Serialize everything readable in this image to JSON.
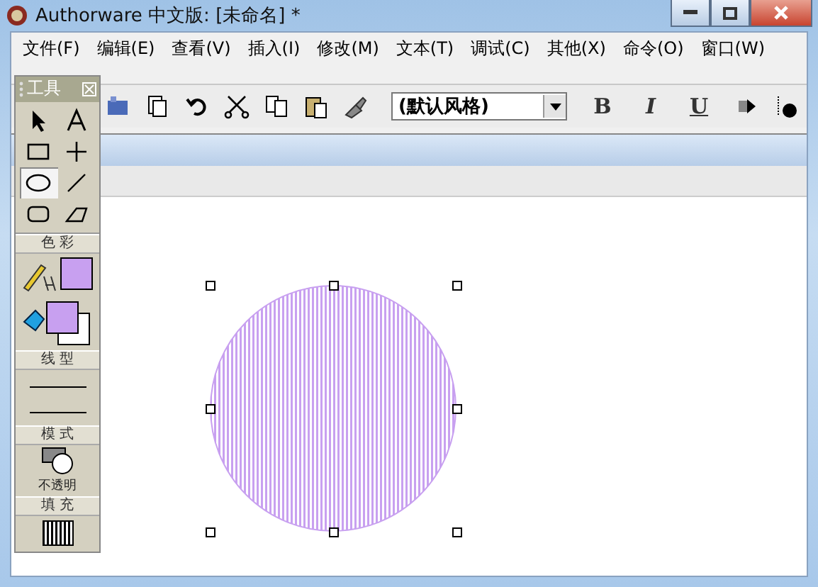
{
  "window": {
    "title": "Authorware 中文版: [未命名] *"
  },
  "menu": [
    "文件(F)",
    "编辑(E)",
    "查看(V)",
    "插入(I)",
    "修改(M)",
    "文本(T)",
    "调试(C)",
    "其他(X)",
    "命令(O)",
    "窗口(W)"
  ],
  "toolbar": {
    "style_select": {
      "value": "(默认风格)"
    },
    "format_buttons": [
      "B",
      "I",
      "U"
    ]
  },
  "toolbox": {
    "title": "工具",
    "tools": [
      {
        "kind": "pointer",
        "selected": false
      },
      {
        "kind": "text",
        "selected": false
      },
      {
        "kind": "rect",
        "selected": false
      },
      {
        "kind": "cross",
        "selected": false
      },
      {
        "kind": "ellipse",
        "selected": true
      },
      {
        "kind": "line",
        "selected": false
      },
      {
        "kind": "rounded-rect",
        "selected": false
      },
      {
        "kind": "polygon",
        "selected": false
      }
    ],
    "color_label": "色 彩",
    "swatches": [
      {
        "color": "#c8a0f0"
      },
      {
        "color": "#c8a0f0"
      },
      {
        "color": "#ffffff"
      }
    ],
    "line_label": "线 型",
    "mode_label": "模 式",
    "mode_text": "不透明",
    "fill_label": "填 充"
  },
  "canvas": {
    "shape": {
      "kind": "ellipse",
      "selected": true,
      "color": "#c8a0f0"
    }
  }
}
